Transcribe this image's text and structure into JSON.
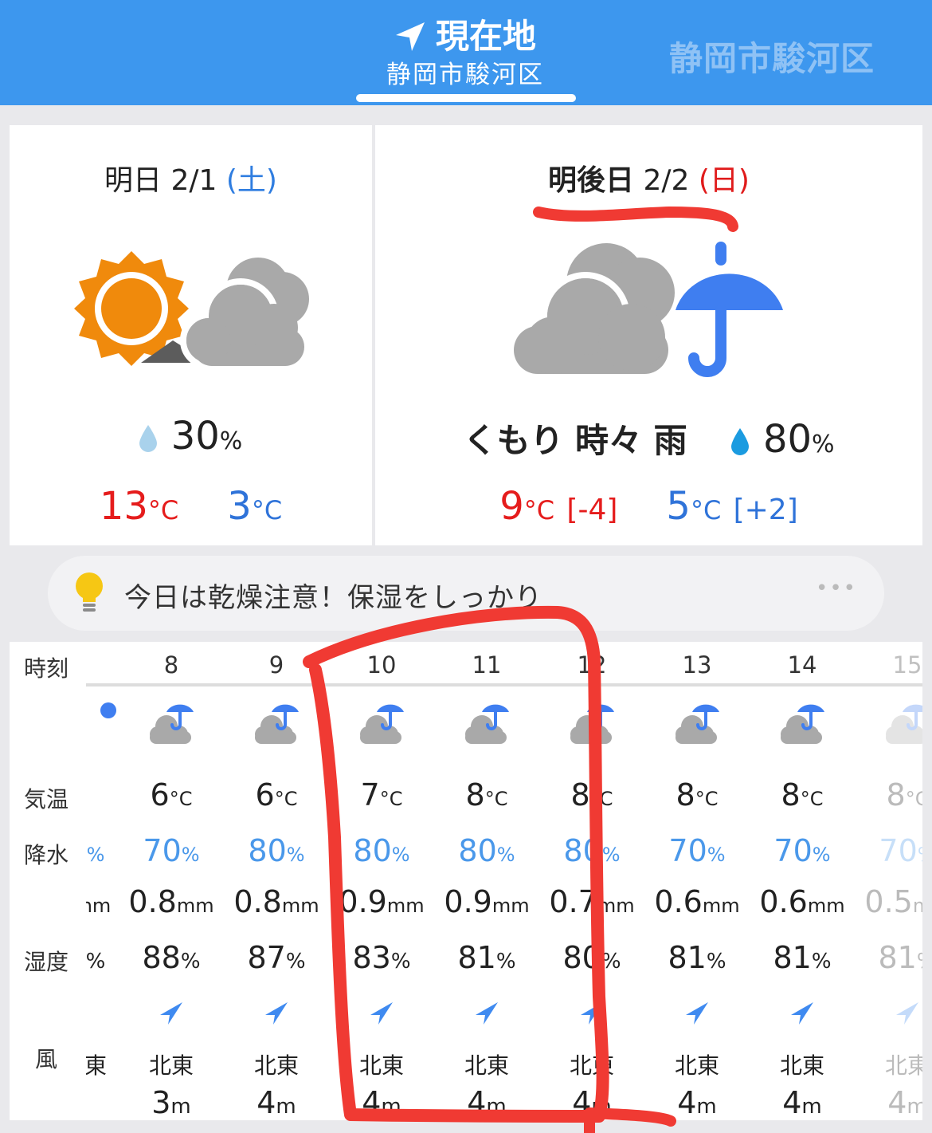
{
  "header": {
    "current_tab": {
      "title": "現在地",
      "subtitle": "静岡市駿河区"
    },
    "other_tab": "静岡市駿河区"
  },
  "tomorrow": {
    "day_label": "明日",
    "date": "2/1",
    "weekday": "(土)",
    "weather_icon": "sunny-then-cloudy-icon",
    "precip_percent": "30",
    "precip_unit": "%",
    "high": "13",
    "low": "3",
    "temp_unit": "°C"
  },
  "day_after": {
    "day_label": "明後日",
    "date": "2/2",
    "weekday": "(日)",
    "weather_icon": "cloudy-with-rain-umbrella-icon",
    "condition": "くもり 時々 雨",
    "precip_percent": "80",
    "precip_unit": "%",
    "high": "9",
    "high_diff": "[-4]",
    "low": "5",
    "low_diff": "[+2]",
    "temp_unit": "°C"
  },
  "tip": {
    "icon": "lightbulb-icon",
    "text": "今日は乾燥注意！保湿をしっかり",
    "more": "•••"
  },
  "hourly": {
    "labels": {
      "time": "時刻",
      "temp": "気温",
      "precip": "降水",
      "humidity": "湿度",
      "wind": "風"
    },
    "units": {
      "temp": "°C",
      "pct": "%",
      "mm": "mm",
      "wind_speed": "m"
    },
    "partial_left": {
      "precip": "%",
      "mm": "nm",
      "humidity": "%",
      "wind": "東"
    },
    "hours": [
      {
        "hour": "8",
        "temp": "6",
        "precip": "70",
        "mm": "0.8",
        "humidity": "88",
        "wind_dir": "北東",
        "wind_speed": "3"
      },
      {
        "hour": "9",
        "temp": "6",
        "precip": "80",
        "mm": "0.8",
        "humidity": "87",
        "wind_dir": "北東",
        "wind_speed": "4"
      },
      {
        "hour": "10",
        "temp": "7",
        "precip": "80",
        "mm": "0.9",
        "humidity": "83",
        "wind_dir": "北東",
        "wind_speed": "4"
      },
      {
        "hour": "11",
        "temp": "8",
        "precip": "80",
        "mm": "0.9",
        "humidity": "81",
        "wind_dir": "北東",
        "wind_speed": "4"
      },
      {
        "hour": "12",
        "temp": "8",
        "precip": "80",
        "mm": "0.7",
        "humidity": "80",
        "wind_dir": "北東",
        "wind_speed": "4"
      },
      {
        "hour": "13",
        "temp": "8",
        "precip": "70",
        "mm": "0.6",
        "humidity": "81",
        "wind_dir": "北東",
        "wind_speed": "4"
      },
      {
        "hour": "14",
        "temp": "8",
        "precip": "70",
        "mm": "0.6",
        "humidity": "81",
        "wind_dir": "北東",
        "wind_speed": "4"
      },
      {
        "hour": "15",
        "temp": "8",
        "precip": "70",
        "mm": "0.5",
        "humidity": "81",
        "wind_dir": "北東",
        "wind_speed": "4"
      }
    ]
  },
  "colors": {
    "header_bg": "#3d97ee",
    "high_temp": "#e51c1c",
    "low_temp": "#2f73d9",
    "precip": "#4a98ea",
    "annotation": "#f03a33",
    "umbrella": "#3f7ef0"
  }
}
